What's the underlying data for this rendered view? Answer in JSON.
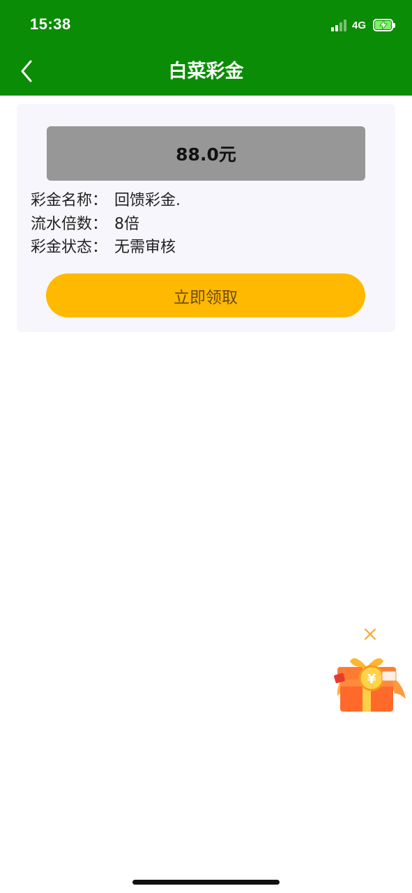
{
  "status_bar": {
    "time": "15:38",
    "network": "4G"
  },
  "nav": {
    "title": "白菜彩金"
  },
  "bonus": {
    "amount": "88.0元",
    "rows": [
      {
        "label": "彩金名称",
        "value": "回馈彩金."
      },
      {
        "label": "流水倍数",
        "value": "8倍"
      },
      {
        "label": "彩金状态",
        "value": "无需审核"
      }
    ],
    "separator": "：",
    "claim_label": "立即领取"
  },
  "floating_widget": {
    "icon": "gift-box-icon",
    "close_icon": "close-icon",
    "currency_symbol": "¥"
  },
  "colors": {
    "header": "#0b8c06",
    "amount_box": "#979797",
    "claim_button": "#ffb900",
    "card_bg": "#f6f6fc"
  }
}
